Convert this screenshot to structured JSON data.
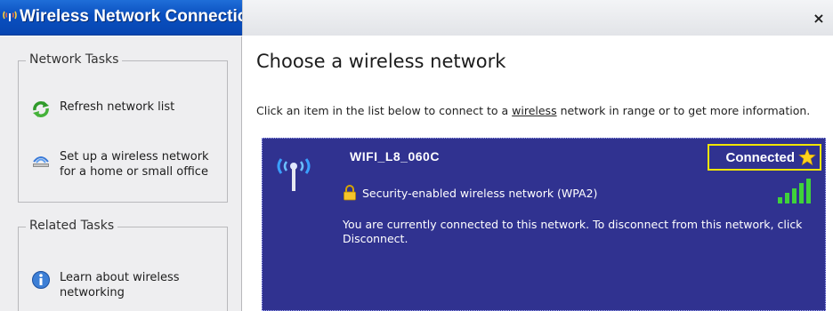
{
  "window": {
    "title": "Wireless Network Connection",
    "close_label": "×",
    "accent_color": "#0a4fbf"
  },
  "network_tasks": {
    "title": "Network Tasks",
    "items": [
      {
        "label": "Refresh network list",
        "icon": "refresh-icon"
      },
      {
        "label": "Set up a wireless network for a home or small office",
        "icon": "wireless-setup-icon"
      }
    ]
  },
  "related_tasks": {
    "title": "Related Tasks",
    "items": [
      {
        "label": "Learn about wireless networking",
        "icon": "info-icon"
      }
    ]
  },
  "main": {
    "heading": "Choose a wireless network",
    "instructions_pre": "Click an item in the list below to connect to a ",
    "instructions_link": "wireless",
    "instructions_post": " network in range or to get more information."
  },
  "network": {
    "ssid": "WIFI_L8_060C",
    "status": "Connected",
    "security": "Security-enabled wireless network (WPA2)",
    "description": "You are currently connected to this network. To disconnect from this network, click Disconnect.",
    "card_color": "#303290",
    "highlight_color": "#f2e600"
  }
}
